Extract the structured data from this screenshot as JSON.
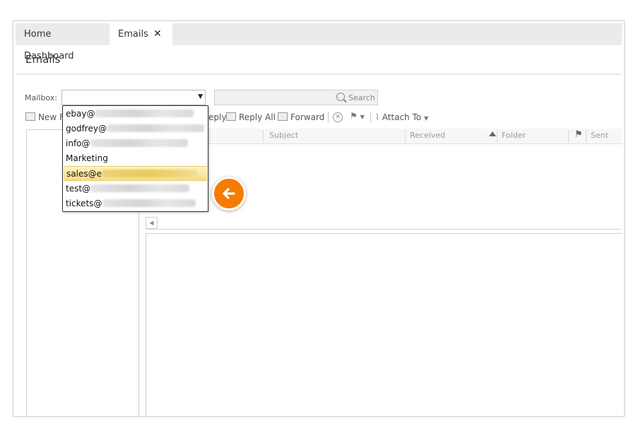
{
  "tabs": [
    {
      "label": "Home Dashboard"
    },
    {
      "label": "Emails",
      "close": "✕"
    }
  ],
  "page_title": "Emails",
  "mailbox": {
    "label": "Mailbox:",
    "value": "",
    "options": [
      {
        "label": "ebay@"
      },
      {
        "label": "godfrey@"
      },
      {
        "label": "info@"
      },
      {
        "label": "Marketing"
      },
      {
        "label": "sales@e",
        "selected": true
      },
      {
        "label": "test@"
      },
      {
        "label": "tickets@"
      }
    ]
  },
  "search": {
    "placeholder": "Search"
  },
  "toolbar": {
    "new_label": "New F",
    "reply_label": "eply",
    "reply_all_label": "Reply All",
    "forward_label": "Forward",
    "attach_label": "Attach To"
  },
  "grid": {
    "columns": [
      "Subject",
      "Received",
      "Folder",
      "Sent"
    ],
    "sort_column": "Received",
    "sort_direction": "ascending"
  },
  "colors": {
    "accent": "#f57c00",
    "selected_highlight": "#f6de86"
  },
  "icons": [
    "close-icon",
    "search-icon",
    "new-folder-icon",
    "reply-all-icon",
    "forward-icon",
    "delete-circle-icon",
    "flag-icon",
    "attach-icon",
    "arrow-left-icon"
  ]
}
